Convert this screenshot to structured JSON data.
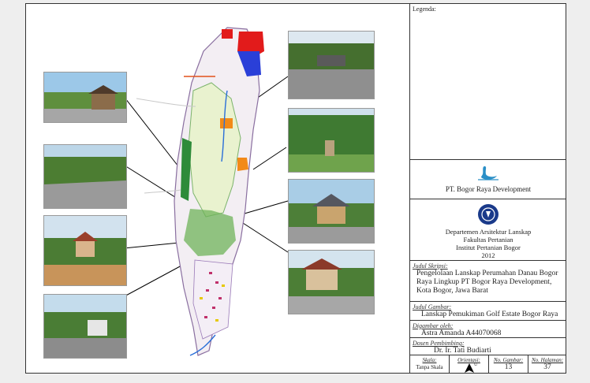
{
  "legend_label": "Legenda:",
  "company_name": "PT. Bogor Raya Development",
  "institution": {
    "dept": "Departemen Arsitektur Lanskap",
    "faculty": "Fakultas Pertanian",
    "university": "Institut Pertanian Bogor",
    "year": "2012"
  },
  "thesis": {
    "label": "Judul Skripsi:",
    "lines": [
      "Pengelolaan Lanskap Perumahan Danau Bogor",
      "Raya Lingkup PT Bogor Raya Development,",
      "Kota Bogor, Jawa Barat"
    ]
  },
  "drawing_title": {
    "label": "Judul Gambar:",
    "value": "Lanskap Pemukiman Golf Estate Bogor Raya"
  },
  "drawn_by": {
    "label": "Digambar oleh:",
    "value": "Astra Amanda A44070068"
  },
  "supervisor": {
    "label": "Dosen Pembimbing:",
    "value": "Dr. Ir. Tati Budiarti"
  },
  "footer": {
    "scale_label": "Skala:",
    "scale_value": "Tanpa Skala",
    "orientation_label": "Orientasi:",
    "orientation_value": "U",
    "drawing_no_label": "No. Gambar:",
    "drawing_no_value": "13",
    "page_no_label": "No. Halaman:",
    "page_no_value": "37"
  }
}
